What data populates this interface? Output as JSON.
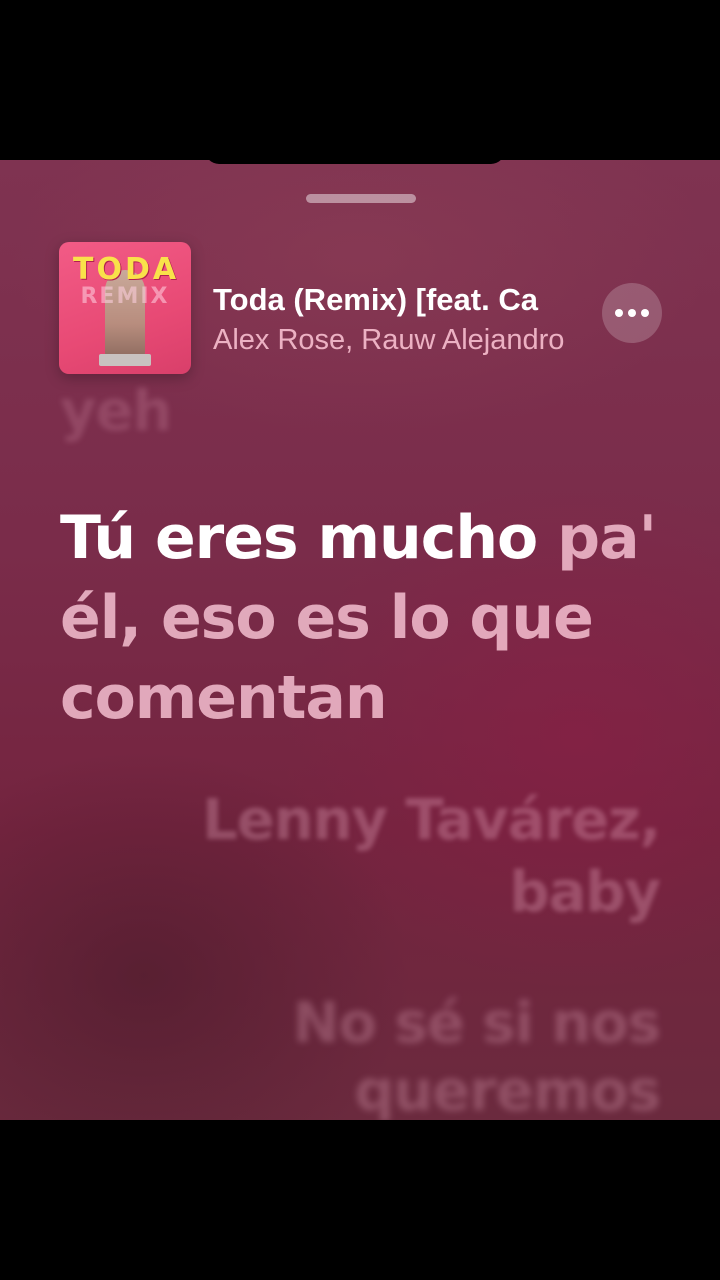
{
  "now_playing": {
    "title": "Toda (Remix) [feat. Ca",
    "artist": "Alex Rose, Rauw Alejandro",
    "artwork": {
      "title_text": "TODA",
      "subtitle_text": "REMIX",
      "colors": {
        "background": "#e84a75",
        "title": "#f9e24a"
      }
    },
    "more_icon": "ellipsis-icon"
  },
  "lyrics": {
    "previous": "yeh",
    "current_sung": "Tú eres mucho",
    "current_unsung": "pa' él, eso es lo que comentan",
    "next": "Lenny Tavárez, baby",
    "after_next": "No sé si nos queremos"
  },
  "theme": {
    "background": "#7a2c4a",
    "accent": "#ffffff"
  }
}
